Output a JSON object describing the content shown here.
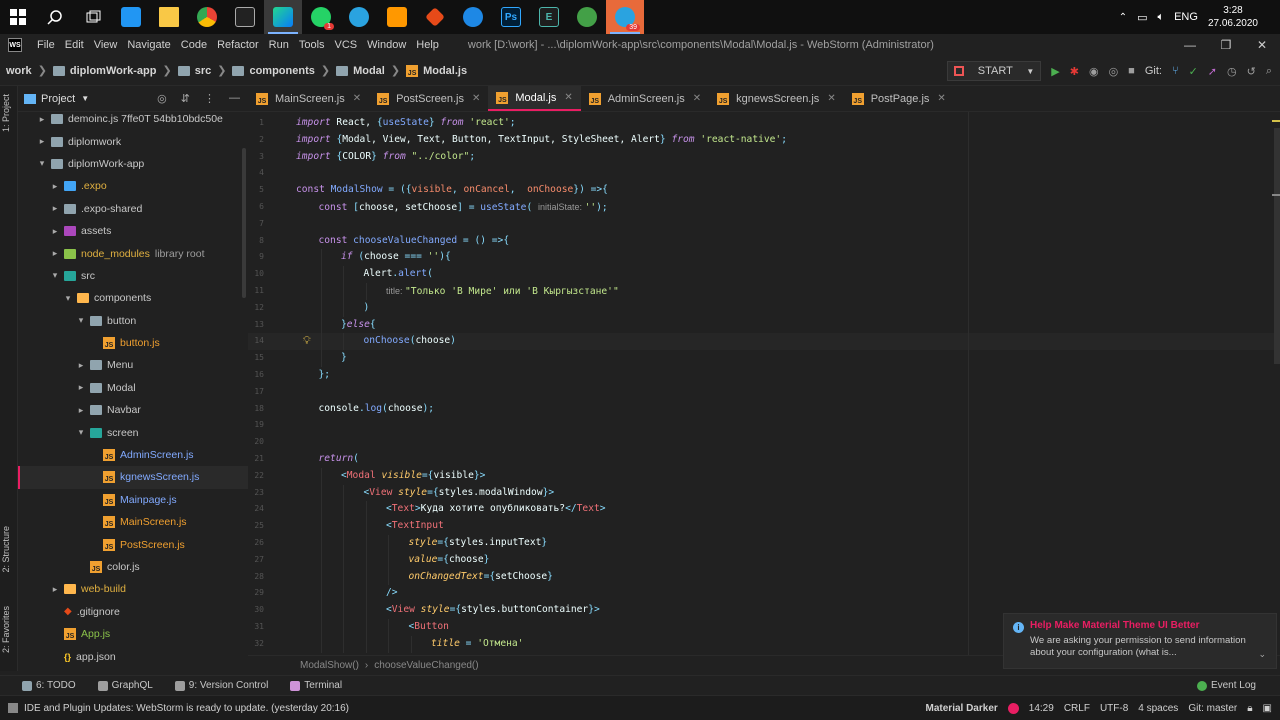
{
  "taskbar": {
    "icons": [
      "windows-icon",
      "search-icon",
      "task-view-icon",
      "app-icon",
      "file-explorer-icon",
      "chrome-icon",
      "terminal-icon",
      "webstorm-icon",
      "whatsapp-icon",
      "telegram-icon",
      "sublime-icon",
      "git-icon",
      "vscode-blue-icon",
      "photoshop-icon",
      "app-e-icon",
      "app-green-icon",
      "telegram-2-icon"
    ],
    "whatsapp_badge": "1",
    "telegram_badge": "39",
    "lang": "ENG",
    "time": "3:28",
    "date": "27.06.2020"
  },
  "menubar": {
    "items": [
      "File",
      "Edit",
      "View",
      "Navigate",
      "Code",
      "Refactor",
      "Run",
      "Tools",
      "VCS",
      "Window",
      "Help"
    ],
    "title": "work [D:\\work] - ...\\diplomWork-app\\src\\components\\Modal\\Modal.js - WebStorm (Administrator)"
  },
  "navbar": {
    "crumbs": [
      "work",
      "diplomWork-app",
      "src",
      "components",
      "Modal",
      "Modal.js"
    ],
    "run_config": "START",
    "git_label": "Git:"
  },
  "project": {
    "header": "Project",
    "side_tab": "1: Project",
    "structure_tab": "2: Structure",
    "favorites_tab": "2: Favorites",
    "tree": [
      {
        "label": "demoinc.js 7ffe0T 54bb10bdc50e",
        "level": 1,
        "type": "folder",
        "arrow": "▸",
        "color": "#90a4ae"
      },
      {
        "label": "diplomwork",
        "level": 1,
        "type": "folder",
        "arrow": "▸",
        "color": "#90a4ae"
      },
      {
        "label": "diplomWork-app",
        "level": 1,
        "type": "folder",
        "arrow": "▾",
        "color": "#90a4ae"
      },
      {
        "label": ".expo",
        "level": 2,
        "type": "folder",
        "arrow": "▸",
        "color": "#42a5f5",
        "text_color": "#e0b040"
      },
      {
        "label": ".expo-shared",
        "level": 2,
        "type": "folder",
        "arrow": "▸",
        "color": "#90a4ae"
      },
      {
        "label": "assets",
        "level": 2,
        "type": "folder",
        "arrow": "▸",
        "color": "#ab47bc"
      },
      {
        "label": "node_modules",
        "suffix": "library root",
        "level": 2,
        "type": "folder",
        "arrow": "▸",
        "color": "#8bc34a",
        "text_color": "#e0b040"
      },
      {
        "label": "src",
        "level": 2,
        "type": "folder",
        "arrow": "▾",
        "color": "#26a69a"
      },
      {
        "label": "components",
        "level": 3,
        "type": "folder",
        "arrow": "▾",
        "color": "#ffb74d"
      },
      {
        "label": "button",
        "level": 4,
        "type": "folder",
        "arrow": "▾",
        "color": "#90a4ae"
      },
      {
        "label": "button.js",
        "level": 5,
        "type": "js",
        "arrow": "",
        "text_color": "#f0a030"
      },
      {
        "label": "Menu",
        "level": 4,
        "type": "folder",
        "arrow": "▸",
        "color": "#90a4ae"
      },
      {
        "label": "Modal",
        "level": 4,
        "type": "folder",
        "arrow": "▸",
        "color": "#90a4ae"
      },
      {
        "label": "Navbar",
        "level": 4,
        "type": "folder",
        "arrow": "▸",
        "color": "#90a4ae"
      },
      {
        "label": "screen",
        "level": 4,
        "type": "folder",
        "arrow": "▾",
        "color": "#26a69a"
      },
      {
        "label": "AdminScreen.js",
        "level": 5,
        "type": "js",
        "arrow": "",
        "text_color": "#82aaff"
      },
      {
        "label": "kgnewsScreen.js",
        "level": 5,
        "type": "js",
        "arrow": "",
        "text_color": "#82aaff",
        "selected": true
      },
      {
        "label": "Mainpage.js",
        "level": 5,
        "type": "js",
        "arrow": "",
        "text_color": "#82aaff"
      },
      {
        "label": "MainScreen.js",
        "level": 5,
        "type": "js",
        "arrow": "",
        "text_color": "#f0a030"
      },
      {
        "label": "PostScreen.js",
        "level": 5,
        "type": "js",
        "arrow": "",
        "text_color": "#f0a030"
      },
      {
        "label": "color.js",
        "level": 4,
        "type": "js",
        "arrow": "",
        "text_color": "#c8c8c8"
      },
      {
        "label": "web-build",
        "level": 2,
        "type": "folder",
        "arrow": "▸",
        "color": "#ffb74d",
        "text_color": "#e0b040"
      },
      {
        "label": ".gitignore",
        "level": 2,
        "type": "git",
        "arrow": "",
        "text_color": "#c8c8c8"
      },
      {
        "label": "App.js",
        "level": 2,
        "type": "js",
        "arrow": "",
        "text_color": "#8bc34a"
      },
      {
        "label": "app.json",
        "level": 2,
        "type": "json",
        "arrow": "",
        "text_color": "#c8c8c8"
      }
    ]
  },
  "tabs": [
    {
      "label": "MainScreen.js",
      "active": false
    },
    {
      "label": "PostScreen.js",
      "active": false
    },
    {
      "label": "Modal.js",
      "active": true
    },
    {
      "label": "AdminScreen.js",
      "active": false
    },
    {
      "label": "kgnewsScreen.js",
      "active": false
    },
    {
      "label": "PostPage.js",
      "active": false
    }
  ],
  "editor": {
    "current_line": 14,
    "lines": [
      {
        "n": "1",
        "indent": 0,
        "tokens": [
          [
            "kw",
            "import"
          ],
          [
            "id",
            " React, "
          ],
          [
            "pun",
            "{"
          ],
          [
            "fn",
            "useState"
          ],
          [
            "pun",
            "}"
          ],
          [
            "kw",
            " from "
          ],
          [
            "str",
            "'react'"
          ],
          [
            "pun",
            ";"
          ]
        ]
      },
      {
        "n": "2",
        "indent": 0,
        "tokens": [
          [
            "kw",
            "import"
          ],
          [
            "id",
            " "
          ],
          [
            "pun",
            "{"
          ],
          [
            "id",
            "Modal, View, Text, Button, TextInput, StyleSheet, Alert"
          ],
          [
            "pun",
            "}"
          ],
          [
            "kw",
            " from "
          ],
          [
            "str",
            "'react-native'"
          ],
          [
            "pun",
            ";"
          ]
        ]
      },
      {
        "n": "3",
        "indent": 0,
        "tokens": [
          [
            "kw",
            "import"
          ],
          [
            "id",
            " "
          ],
          [
            "pun",
            "{"
          ],
          [
            "id",
            "COLOR"
          ],
          [
            "pun",
            "}"
          ],
          [
            "kw",
            " from "
          ],
          [
            "str",
            "\"../color\""
          ],
          [
            "pun",
            ";"
          ]
        ]
      },
      {
        "n": "4",
        "indent": 0,
        "tokens": []
      },
      {
        "n": "5",
        "indent": 0,
        "tokens": [
          [
            "kw2",
            "const "
          ],
          [
            "fn",
            "ModalShow"
          ],
          [
            "pun",
            " = ("
          ],
          [
            "pun",
            "{"
          ],
          [
            "var",
            "visible"
          ],
          [
            "pun",
            ", "
          ],
          [
            "var",
            "onCancel"
          ],
          [
            "pun",
            ",  "
          ],
          [
            "var",
            "onChoose"
          ],
          [
            "pun",
            "}"
          ],
          [
            "pun",
            ") =>{"
          ]
        ]
      },
      {
        "n": "6",
        "indent": 1,
        "tokens": [
          [
            "kw2",
            "const "
          ],
          [
            "pun",
            "["
          ],
          [
            "id",
            "choose, setChoose"
          ],
          [
            "pun",
            "] = "
          ],
          [
            "fn",
            "useState"
          ],
          [
            "pun",
            "( "
          ],
          [
            "hint",
            "initialState: "
          ],
          [
            "str",
            "''"
          ],
          [
            "pun",
            ");"
          ]
        ]
      },
      {
        "n": "7",
        "indent": 0,
        "tokens": []
      },
      {
        "n": "8",
        "indent": 1,
        "tokens": [
          [
            "kw2",
            "const "
          ],
          [
            "fn",
            "chooseValueChanged"
          ],
          [
            "pun",
            " = () =>{"
          ]
        ]
      },
      {
        "n": "9",
        "indent": 2,
        "tokens": [
          [
            "kw",
            "if "
          ],
          [
            "pun",
            "("
          ],
          [
            "id",
            "choose "
          ],
          [
            "pun",
            "=== "
          ],
          [
            "str",
            "''"
          ],
          [
            "pun",
            "){"
          ]
        ]
      },
      {
        "n": "10",
        "indent": 3,
        "tokens": [
          [
            "id",
            "Alert"
          ],
          [
            "pun",
            "."
          ],
          [
            "fn",
            "alert"
          ],
          [
            "pun",
            "("
          ]
        ]
      },
      {
        "n": "11",
        "indent": 4,
        "tokens": [
          [
            "hint",
            "title: "
          ],
          [
            "str",
            "\"Только 'В Мире' или 'В Кыргызстане'\""
          ]
        ]
      },
      {
        "n": "12",
        "indent": 3,
        "tokens": [
          [
            "pun",
            ")"
          ]
        ]
      },
      {
        "n": "13",
        "indent": 2,
        "tokens": [
          [
            "pun",
            "}"
          ],
          [
            "kw",
            "else"
          ],
          [
            "pun",
            "{"
          ]
        ]
      },
      {
        "n": "14",
        "indent": 3,
        "tokens": [
          [
            "fn",
            "onChoose"
          ],
          [
            "pun",
            "("
          ],
          [
            "id",
            "choose"
          ],
          [
            "pun",
            ")"
          ]
        ]
      },
      {
        "n": "15",
        "indent": 2,
        "tokens": [
          [
            "pun",
            "}"
          ]
        ]
      },
      {
        "n": "16",
        "indent": 1,
        "tokens": [
          [
            "pun",
            "};"
          ]
        ]
      },
      {
        "n": "17",
        "indent": 0,
        "tokens": []
      },
      {
        "n": "18",
        "indent": 1,
        "tokens": [
          [
            "id",
            "console"
          ],
          [
            "pun",
            "."
          ],
          [
            "fn",
            "log"
          ],
          [
            "pun",
            "("
          ],
          [
            "id",
            "choose"
          ],
          [
            "pun",
            ");"
          ]
        ]
      },
      {
        "n": "19",
        "indent": 0,
        "tokens": []
      },
      {
        "n": "20",
        "indent": 0,
        "tokens": []
      },
      {
        "n": "21",
        "indent": 1,
        "tokens": [
          [
            "kw",
            "return"
          ],
          [
            "pun",
            "("
          ]
        ]
      },
      {
        "n": "22",
        "indent": 2,
        "tokens": [
          [
            "pun",
            "<"
          ],
          [
            "tag",
            "Modal "
          ],
          [
            "attr",
            "visible"
          ],
          [
            "pun",
            "={"
          ],
          [
            "id",
            "visible"
          ],
          [
            "pun",
            "}>"
          ]
        ]
      },
      {
        "n": "23",
        "indent": 3,
        "tokens": [
          [
            "pun",
            "<"
          ],
          [
            "tag",
            "View "
          ],
          [
            "attr",
            "style"
          ],
          [
            "pun",
            "={"
          ],
          [
            "id",
            "styles.modalWindow"
          ],
          [
            "pun",
            "}>"
          ]
        ]
      },
      {
        "n": "24",
        "indent": 4,
        "tokens": [
          [
            "pun",
            "<"
          ],
          [
            "tag",
            "Text"
          ],
          [
            "pun",
            ">"
          ],
          [
            "id",
            "Куда хотите опубликовать?"
          ],
          [
            "pun",
            "</"
          ],
          [
            "tag",
            "Text"
          ],
          [
            "pun",
            ">"
          ]
        ]
      },
      {
        "n": "25",
        "indent": 4,
        "tokens": [
          [
            "pun",
            "<"
          ],
          [
            "tag",
            "TextInput"
          ]
        ]
      },
      {
        "n": "26",
        "indent": 5,
        "tokens": [
          [
            "attr",
            "style"
          ],
          [
            "pun",
            "={"
          ],
          [
            "id",
            "styles.inputText"
          ],
          [
            "pun",
            "}"
          ]
        ]
      },
      {
        "n": "27",
        "indent": 5,
        "tokens": [
          [
            "attr",
            "value"
          ],
          [
            "pun",
            "={"
          ],
          [
            "id",
            "choose"
          ],
          [
            "pun",
            "}"
          ]
        ]
      },
      {
        "n": "28",
        "indent": 5,
        "tokens": [
          [
            "attr",
            "onChangedText"
          ],
          [
            "pun",
            "={"
          ],
          [
            "id",
            "setChoose"
          ],
          [
            "pun",
            "}"
          ]
        ]
      },
      {
        "n": "29",
        "indent": 4,
        "tokens": [
          [
            "pun",
            "/>"
          ]
        ]
      },
      {
        "n": "30",
        "indent": 4,
        "tokens": [
          [
            "pun",
            "<"
          ],
          [
            "tag",
            "View "
          ],
          [
            "attr",
            "style"
          ],
          [
            "pun",
            "={"
          ],
          [
            "id",
            "styles.buttonContainer"
          ],
          [
            "pun",
            "}>"
          ]
        ]
      },
      {
        "n": "31",
        "indent": 5,
        "tokens": [
          [
            "pun",
            "<"
          ],
          [
            "tag",
            "Button"
          ]
        ]
      },
      {
        "n": "32",
        "indent": 6,
        "tokens": [
          [
            "attr",
            "title "
          ],
          [
            "pun",
            "= "
          ],
          [
            "str",
            "'Отмена'"
          ]
        ]
      }
    ]
  },
  "code_breadcrumb": [
    "ModalShow()",
    "chooseValueChanged()"
  ],
  "notification": {
    "title": "Help Make Material Theme UI Better",
    "body": "We are asking your permission to send information about your configuration (what is..."
  },
  "tool_windows": [
    {
      "label": "6: TODO",
      "icon_color": "#90a4ae"
    },
    {
      "label": "GraphQL",
      "icon_color": "#9e9e9e"
    },
    {
      "label": "9: Version Control",
      "icon_color": "#9e9e9e"
    },
    {
      "label": "Terminal",
      "icon_color": "#ce93d8"
    }
  ],
  "event_log": "Event Log",
  "status": {
    "message": "IDE and Plugin Updates: WebStorm is ready to update. (yesterday 20:16)",
    "theme": "Material Darker",
    "position": "14:29",
    "line_sep": "CRLF",
    "encoding": "UTF-8",
    "indent": "4 spaces",
    "git": "Git: master"
  },
  "colors": {
    "accent": "#e91e63",
    "background": "#212121",
    "js_icon": "#f0a030"
  }
}
